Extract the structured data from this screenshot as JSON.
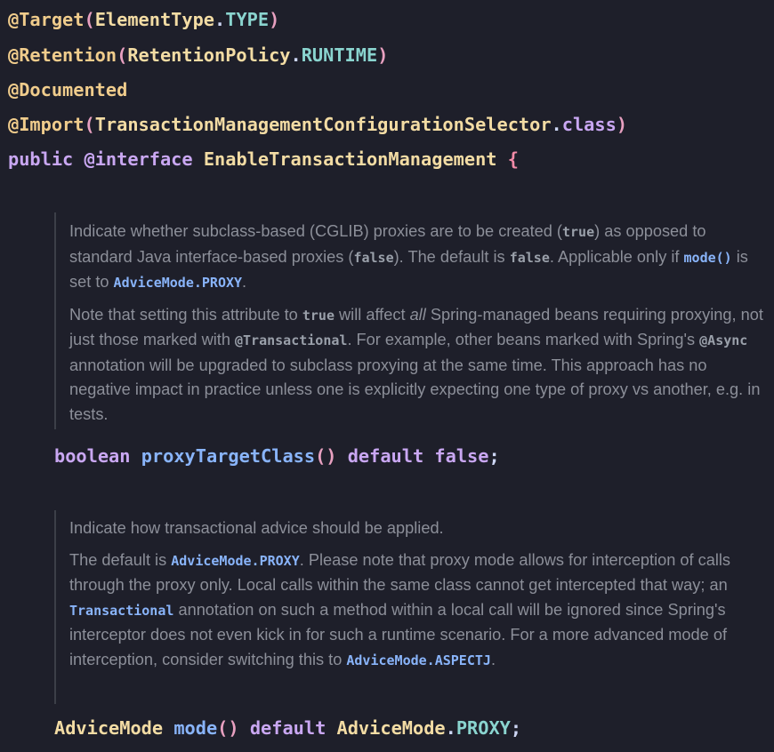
{
  "code": {
    "l1": {
      "ann": "@Target",
      "open": "(",
      "type": "ElementType",
      "dot": ".",
      "const": "TYPE",
      "close": ")"
    },
    "l2": {
      "ann": "@Retention",
      "open": "(",
      "type": "RetentionPolicy",
      "dot": ".",
      "const": "RUNTIME",
      "close": ")"
    },
    "l3": {
      "ann": "@Documented"
    },
    "l4": {
      "ann": "@Import",
      "open": "(",
      "type": "TransactionManagementConfigurationSelector",
      "dot": ".",
      "kw": "class",
      "close": ")"
    },
    "l5": {
      "kw1": "public",
      "kw2": "@interface",
      "name": "EnableTransactionManagement",
      "brace": "{"
    },
    "m1": {
      "type": "boolean",
      "name": "proxyTargetClass",
      "parens": "()",
      "kw": "default",
      "value": "false",
      "semi": ";"
    },
    "m2": {
      "type": "AdviceMode",
      "name": "mode",
      "parens": "()",
      "kw": "default",
      "vtype": "AdviceMode",
      "dot": ".",
      "vconst": "PROXY",
      "semi": ";"
    }
  },
  "doc1": {
    "p1_a": "Indicate whether subclass-based (CGLIB) proxies are to be created (",
    "p1_true": "true",
    "p1_b": ") as opposed to standard Java interface-based proxies (",
    "p1_false": "false",
    "p1_c": "). The default is ",
    "p1_false2": "false",
    "p1_d": ". Applicable only if ",
    "p1_mode": "mode()",
    "p1_e": " is set to ",
    "p1_proxy": "AdviceMode.PROXY",
    "p1_f": ".",
    "p2_a": "Note that setting this attribute to ",
    "p2_true": "true",
    "p2_b": " will affect ",
    "p2_all": "all",
    "p2_c": " Spring-managed beans requiring proxying, not just those marked with ",
    "p2_trans": "@Transactional",
    "p2_d": ". For example, other beans marked with Spring's ",
    "p2_async": "@Async",
    "p2_e": " annotation will be upgraded to subclass proxying at the same time. This approach has no negative impact in practice unless one is explicitly expecting one type of proxy vs another, e.g. in tests."
  },
  "doc2": {
    "p1": "Indicate how transactional advice should be applied.",
    "p2_a": "The default is ",
    "p2_proxy": "AdviceMode.PROXY",
    "p2_b": ". Please note that proxy mode allows for interception of calls through the proxy only. Local calls within the same class cannot get intercepted that way; an ",
    "p2_trans": "Transactional",
    "p2_c": " annotation on such a method within a local call will be ignored since Spring's interceptor does not even kick in for such a runtime scenario. For a more advanced mode of interception, consider switching this to ",
    "p2_aspectj": "AdviceMode.ASPECTJ",
    "p2_d": "."
  }
}
